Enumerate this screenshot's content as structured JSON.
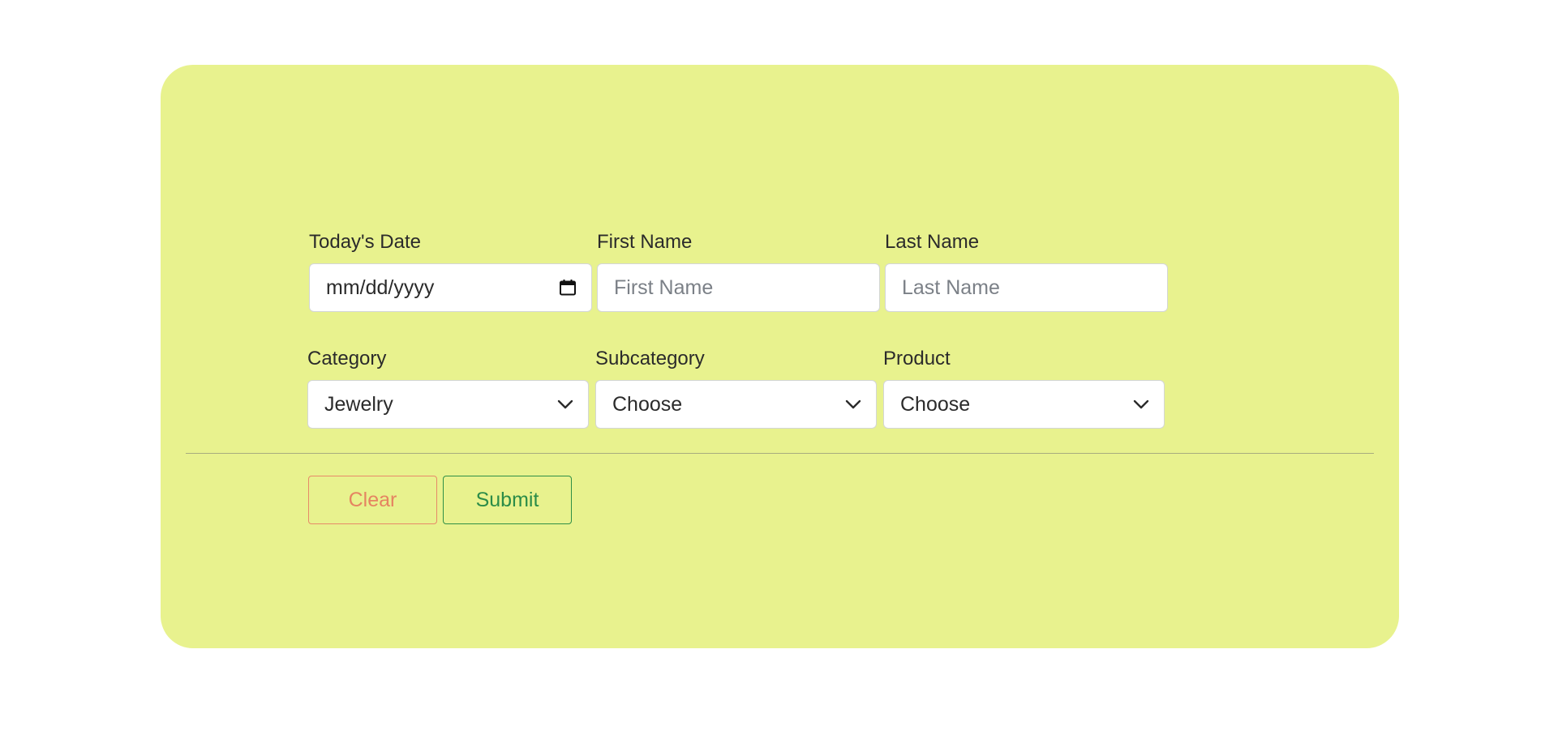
{
  "form": {
    "date": {
      "label": "Today's Date",
      "placeholder": "mm/dd/yyyy"
    },
    "first_name": {
      "label": "First Name",
      "placeholder": "First Name"
    },
    "last_name": {
      "label": "Last Name",
      "placeholder": "Last Name"
    },
    "category": {
      "label": "Category",
      "value": "Jewelry"
    },
    "subcategory": {
      "label": "Subcategory",
      "value": "Choose"
    },
    "product": {
      "label": "Product",
      "value": "Choose"
    }
  },
  "actions": {
    "clear_label": "Clear",
    "submit_label": "Submit"
  },
  "colors": {
    "card_background": "#e8f28e",
    "clear_accent": "#e58461",
    "submit_accent": "#2b8c48"
  },
  "icons": {
    "date": "calendar-icon",
    "select": "chevron-down-icon"
  }
}
